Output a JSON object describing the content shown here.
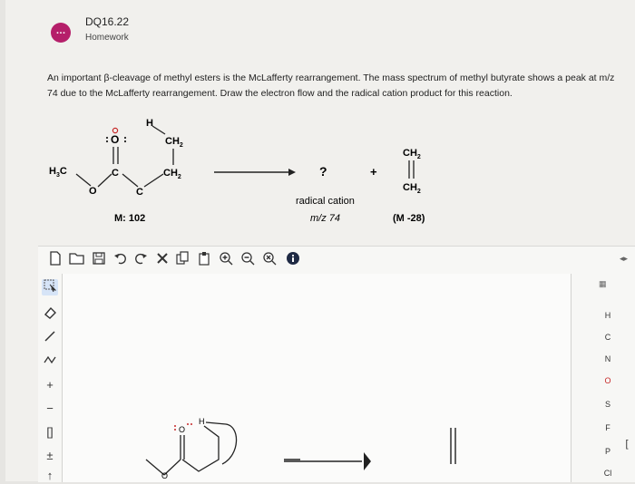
{
  "header": {
    "badge": "…",
    "title": "DQ16.22",
    "subtitle": "Homework"
  },
  "question": "An important β-cleavage of methyl esters is the McLafferty rearrangement. The mass spectrum of methyl butyrate shows a peak at m/z 74 due to the McLafferty rearrangement. Draw the electron flow and the radical cation product for this reaction.",
  "scheme": {
    "reactant": {
      "methyl": "H3C",
      "o_ester": "O",
      "carbonyl_c": "C",
      "carbonyl_o": "O",
      "alpha_c": "C",
      "hydrogen": "H",
      "ch2_top": "CH2",
      "ch2_mid": "CH2",
      "mass": "M: 102"
    },
    "product_unknown": "?",
    "plus": "+",
    "product_label": "radical cation",
    "product_mz": "m/z 74",
    "ethylene_top": "CH2",
    "ethylene_bottom": "CH2",
    "ethylene_mass": "(M -28)"
  },
  "editor": {
    "toolbar_icons": [
      "new-doc-icon",
      "open-icon",
      "save-icon",
      "undo-icon",
      "redo-icon",
      "delete-icon",
      "copy-icon",
      "paste-icon",
      "zoom-in-icon",
      "zoom-out-icon",
      "zoom-reset-icon",
      "info-icon"
    ],
    "left_tools": [
      "select-icon",
      "eraser-icon",
      "single-bond-icon",
      "chain-icon",
      "charge-plus-icon",
      "charge-minus-icon",
      "bracket-icon",
      "plus-minus-icon",
      "arrow-icon"
    ],
    "elements": [
      "H",
      "C",
      "N",
      "O",
      "S",
      "F",
      "P",
      "Cl"
    ],
    "canvas": {
      "o_label": "O",
      "h_label": "H",
      "o_ester": "O"
    }
  },
  "colors": {
    "badge": "#b51f6a",
    "info": "#1f2a44",
    "radical_dot": "#c62828"
  }
}
